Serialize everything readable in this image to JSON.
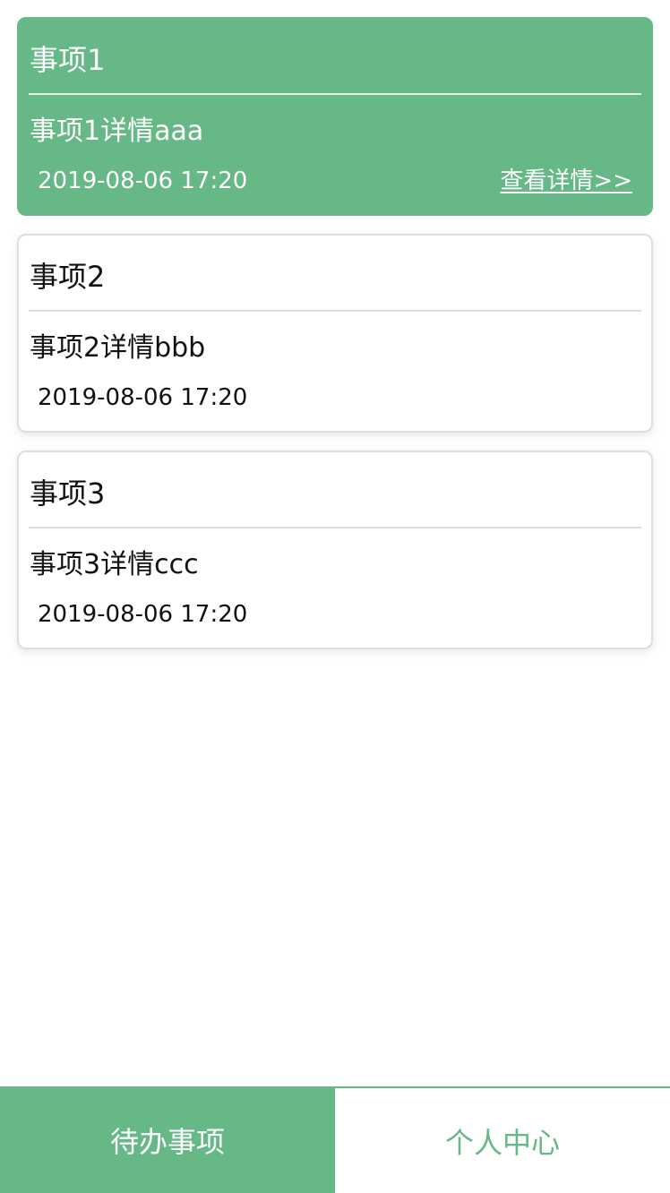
{
  "items": [
    {
      "title": "事项1",
      "detail": "事项1详情aaa",
      "time": "2019-08-06 17:20",
      "link": "查看详情>>"
    },
    {
      "title": "事项2",
      "detail": "事项2详情bbb",
      "time": "2019-08-06 17:20"
    },
    {
      "title": "事项3",
      "detail": "事项3详情ccc",
      "time": "2019-08-06 17:20"
    }
  ],
  "tabs": [
    {
      "label": "待办事项"
    },
    {
      "label": "个人中心"
    }
  ],
  "colors": {
    "accent": "#66b886",
    "card_border": "#dedede",
    "text": "#111111",
    "background": "#ffffff"
  }
}
